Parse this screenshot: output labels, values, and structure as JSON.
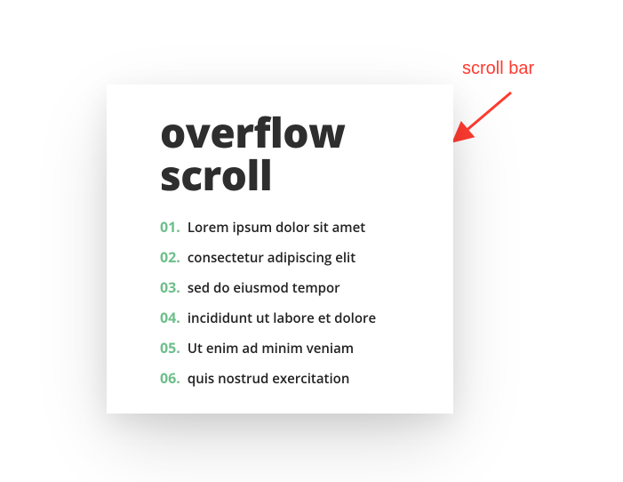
{
  "annotation": {
    "label": "scroll bar"
  },
  "card": {
    "title": "overflow scroll",
    "items": [
      {
        "num": "01.",
        "text": "Lorem ipsum dolor sit amet"
      },
      {
        "num": "02.",
        "text": "consectetur adipiscing elit"
      },
      {
        "num": "03.",
        "text": "sed do eiusmod tempor"
      },
      {
        "num": "04.",
        "text": "incididunt ut labore et dolore"
      },
      {
        "num": "05.",
        "text": "Ut enim ad minim veniam"
      },
      {
        "num": "06.",
        "text": "quis nostrud exercitation"
      }
    ]
  }
}
